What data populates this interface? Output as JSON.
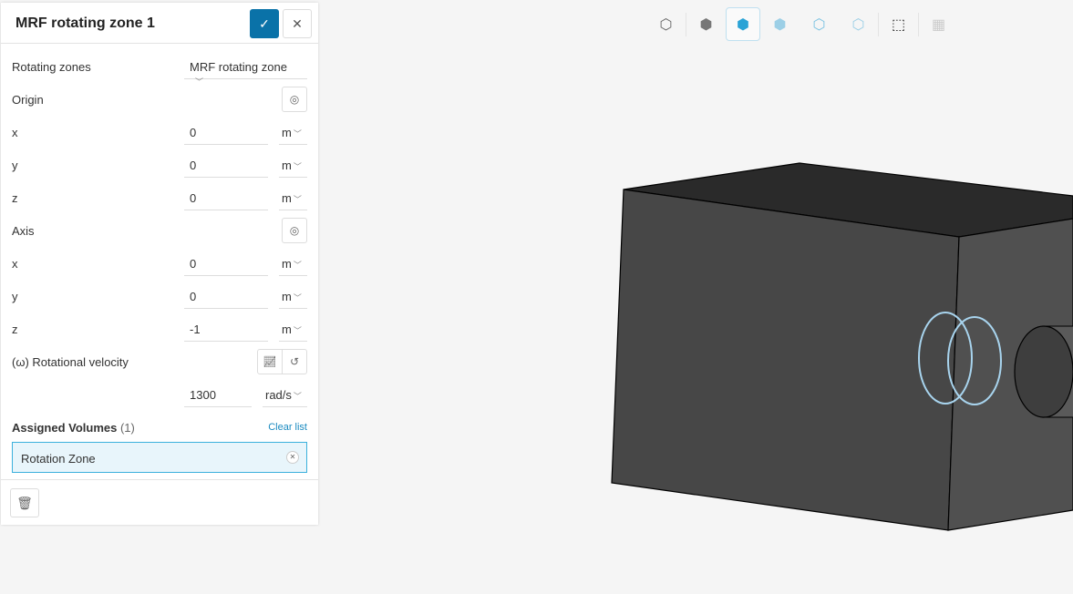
{
  "panel": {
    "title": "MRF rotating zone 1",
    "confirm_icon": "check-icon",
    "cancel_icon": "close-icon"
  },
  "rotating_zones": {
    "label": "Rotating zones",
    "value": "MRF rotating zone"
  },
  "origin": {
    "label": "Origin",
    "x": {
      "label": "x",
      "value": "0",
      "unit": "m"
    },
    "y": {
      "label": "y",
      "value": "0",
      "unit": "m"
    },
    "z": {
      "label": "z",
      "value": "0",
      "unit": "m"
    }
  },
  "axis": {
    "label": "Axis",
    "x": {
      "label": "x",
      "value": "0",
      "unit": "m"
    },
    "y": {
      "label": "y",
      "value": "0",
      "unit": "m"
    },
    "z": {
      "label": "z",
      "value": "-1",
      "unit": "m"
    }
  },
  "rotational_velocity": {
    "label": "(ω) Rotational velocity",
    "value": "1300",
    "unit": "rad/s"
  },
  "assigned": {
    "label": "Assigned Volumes",
    "count": "(1)",
    "clear": "Clear list",
    "items": [
      "Rotation Zone"
    ]
  },
  "toolbar": [
    "cube-outline-icon",
    "cube-solid-icon",
    "cube-highlight-icon",
    "cube-transparent-icon",
    "cube-points-icon",
    "cube-wire-icon",
    "box-select-icon",
    "mesh-icon"
  ],
  "colors": {
    "accent": "#0a72a8",
    "selection": "#a8d4ee",
    "chip_bg": "#e8f5fb"
  }
}
